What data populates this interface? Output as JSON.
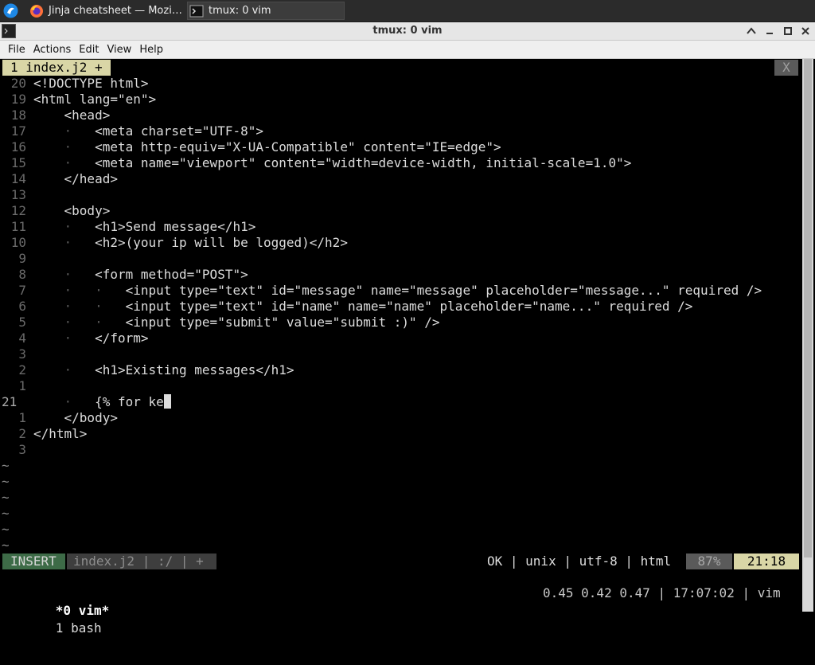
{
  "taskbar": {
    "tasks": [
      {
        "label": "Jinja cheatsheet — Mozi…",
        "icon": "firefox-icon"
      },
      {
        "label": "tmux: 0 vim",
        "icon": "terminal-icon"
      }
    ]
  },
  "window": {
    "title": "tmux: 0 vim"
  },
  "menu": [
    "File",
    "Actions",
    "Edit",
    "View",
    "Help"
  ],
  "vim": {
    "tab_label": "1 index.j2 +",
    "tab_close": "X",
    "lines": [
      {
        "num": "20",
        "indent": 0,
        "text": "<!DOCTYPE html>"
      },
      {
        "num": "19",
        "indent": 0,
        "text": "<html lang=\"en\">"
      },
      {
        "num": "18",
        "indent": 1,
        "text": "<head>"
      },
      {
        "num": "17",
        "indent": 2,
        "text": "<meta charset=\"UTF-8\">"
      },
      {
        "num": "16",
        "indent": 2,
        "text": "<meta http-equiv=\"X-UA-Compatible\" content=\"IE=edge\">"
      },
      {
        "num": "15",
        "indent": 2,
        "text": "<meta name=\"viewport\" content=\"width=device-width, initial-scale=1.0\">"
      },
      {
        "num": "14",
        "indent": 1,
        "text": "</head>"
      },
      {
        "num": "13",
        "indent": 0,
        "text": ""
      },
      {
        "num": "12",
        "indent": 1,
        "text": "<body>"
      },
      {
        "num": "11",
        "indent": 2,
        "text": "<h1>Send message</h1>"
      },
      {
        "num": "10",
        "indent": 2,
        "text": "<h2>(your ip will be logged)</h2>"
      },
      {
        "num": "9",
        "indent": 0,
        "text": ""
      },
      {
        "num": "8",
        "indent": 2,
        "text": "<form method=\"POST\">"
      },
      {
        "num": "7",
        "indent": 3,
        "text": "<input type=\"text\" id=\"message\" name=\"message\" placeholder=\"message...\" required />"
      },
      {
        "num": "6",
        "indent": 3,
        "text": "<input type=\"text\" id=\"name\" name=\"name\" placeholder=\"name...\" required />"
      },
      {
        "num": "5",
        "indent": 3,
        "text": "<input type=\"submit\" value=\"submit :)\" />"
      },
      {
        "num": "4",
        "indent": 2,
        "text": "</form>"
      },
      {
        "num": "3",
        "indent": 0,
        "text": ""
      },
      {
        "num": "2",
        "indent": 2,
        "text": "<h1>Existing messages</h1>"
      },
      {
        "num": "1",
        "indent": 0,
        "text": ""
      },
      {
        "num": "21",
        "indent": 2,
        "text": "{% for ke",
        "current": true
      },
      {
        "num": "1",
        "indent": 1,
        "text": "</body>"
      },
      {
        "num": "2",
        "indent": 0,
        "text": "</html>"
      },
      {
        "num": "3",
        "indent": 0,
        "text": ""
      }
    ],
    "tilde_rows": 6,
    "status": {
      "mode": "INSERT",
      "file": "index.j2 | :/ | +",
      "right": "OK | unix | utf-8 | html",
      "percent": "87%",
      "position": "21:18"
    }
  },
  "tmux": {
    "active_window": "*0 vim*",
    "other_window": "1 bash",
    "right": "0.45 0.42 0.47 | 17:07:02 | vim"
  },
  "colors": {
    "mode_bg": "#3d6b47",
    "tab_bg": "#d9d6a6",
    "position_bg": "#d9d6a6"
  }
}
